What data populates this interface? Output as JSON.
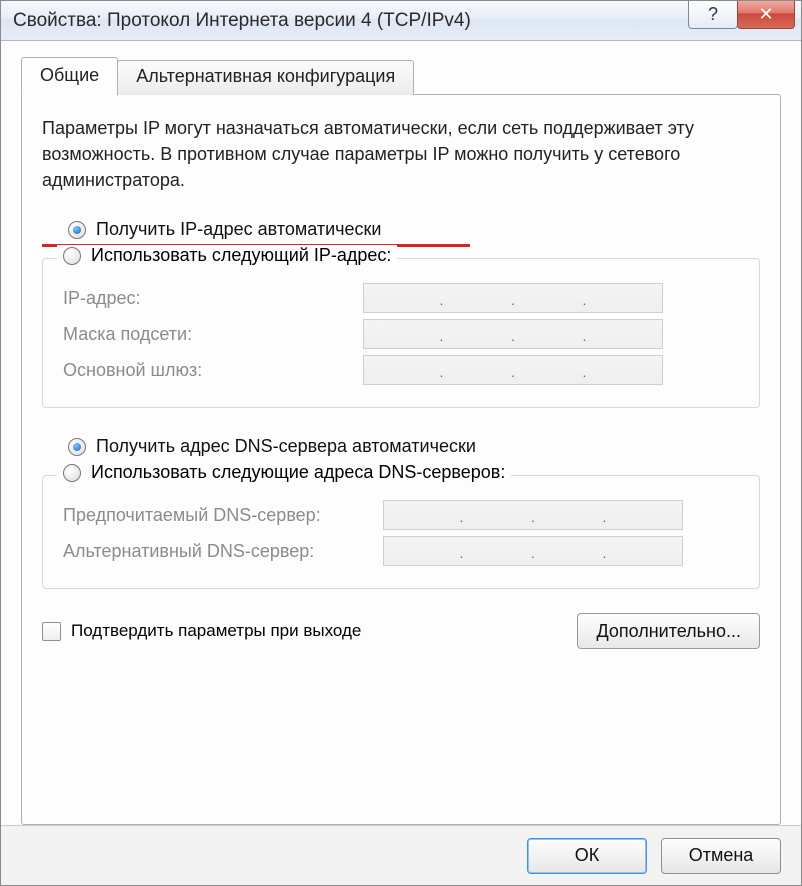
{
  "window": {
    "title": "Свойства: Протокол Интернета версии 4 (TCP/IPv4)"
  },
  "tabs": {
    "general": "Общие",
    "alternate": "Альтернативная конфигурация"
  },
  "description": "Параметры IP могут назначаться автоматически, если сеть поддерживает эту возможность. В противном случае параметры IP можно получить у сетевого администратора.",
  "ip_section": {
    "auto_label": "Получить IP-адрес автоматически",
    "manual_label": "Использовать следующий IP-адрес:",
    "fields": {
      "ip": "IP-адрес:",
      "mask": "Маска подсети:",
      "gateway": "Основной шлюз:"
    }
  },
  "dns_section": {
    "auto_label": "Получить адрес DNS-сервера автоматически",
    "manual_label": "Использовать следующие адреса DNS-серверов:",
    "fields": {
      "preferred": "Предпочитаемый DNS-сервер:",
      "alternate": "Альтернативный DNS-сервер:"
    }
  },
  "validate_checkbox": "Подтвердить параметры при выходе",
  "buttons": {
    "advanced": "Дополнительно...",
    "ok": "ОК",
    "cancel": "Отмена"
  },
  "titlebar_icons": {
    "help": "?",
    "close": "✕"
  }
}
